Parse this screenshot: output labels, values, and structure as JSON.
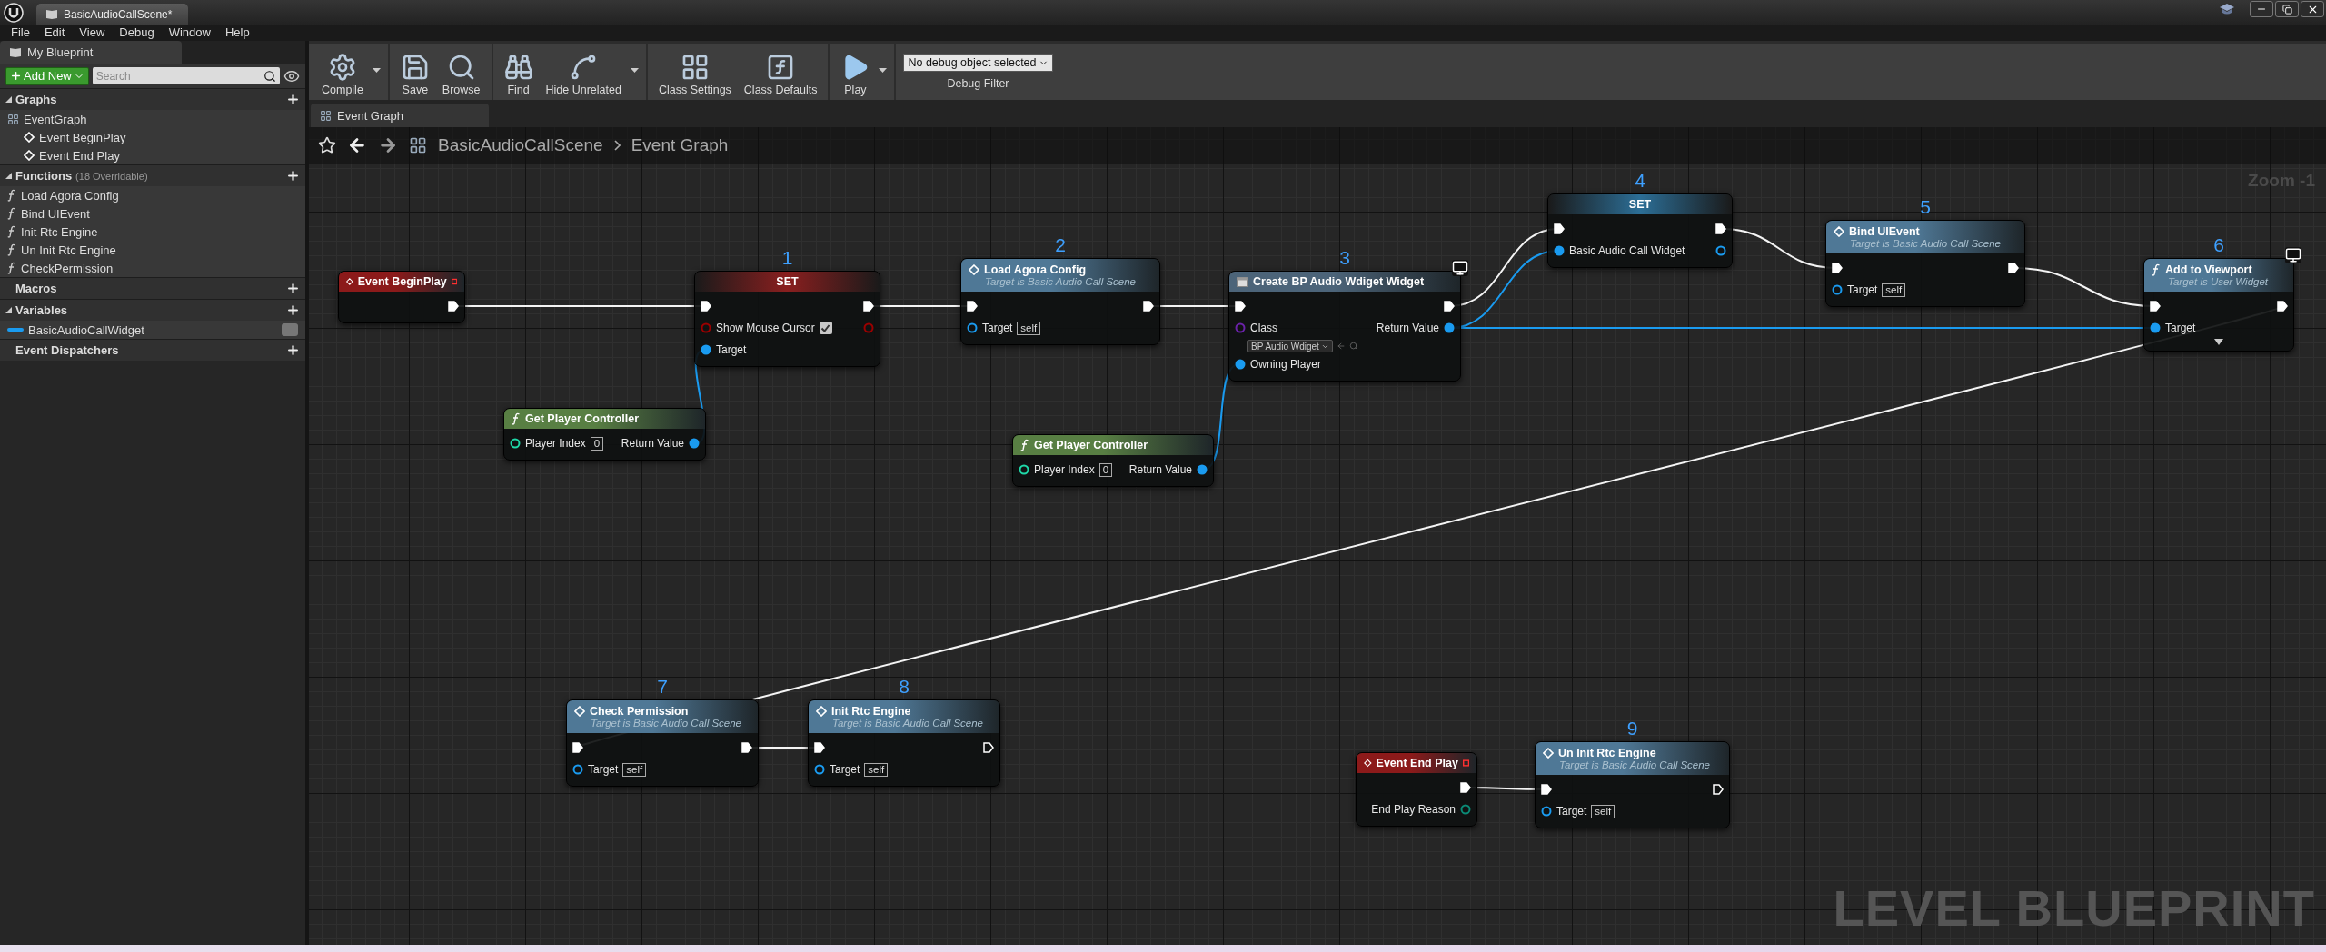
{
  "window": {
    "tab": "BasicAudioCallScene*"
  },
  "menu": [
    "File",
    "Edit",
    "View",
    "Debug",
    "Window",
    "Help"
  ],
  "my_blueprint": {
    "tab": "My Blueprint",
    "add_button": "Add New",
    "search_placeholder": "Search",
    "sections": [
      {
        "title": "Graphs",
        "expanded": true,
        "items": [
          {
            "label": "EventGraph",
            "kind": "graph",
            "children": [
              {
                "label": "Event BeginPlay",
                "kind": "event"
              },
              {
                "label": "Event End Play",
                "kind": "event"
              }
            ]
          }
        ]
      },
      {
        "title": "Functions",
        "note": "(18 Overridable)",
        "expanded": true,
        "items": [
          {
            "label": "Load Agora Config",
            "kind": "function"
          },
          {
            "label": "Bind UIEvent",
            "kind": "function"
          },
          {
            "label": "Init Rtc Engine",
            "kind": "function"
          },
          {
            "label": "Un Init Rtc Engine",
            "kind": "function"
          },
          {
            "label": "CheckPermission",
            "kind": "function"
          }
        ]
      },
      {
        "title": "Macros",
        "expanded": false
      },
      {
        "title": "Variables",
        "expanded": true,
        "items": [
          {
            "label": "BasicAudioCallWidget",
            "kind": "variable"
          }
        ]
      },
      {
        "title": "Event Dispatchers",
        "expanded": false
      }
    ]
  },
  "toolbar": {
    "groups": [
      [
        {
          "label": "Compile",
          "menu": true
        }
      ],
      [
        {
          "label": "Save",
          "menu": false
        },
        {
          "label": "Browse",
          "menu": false
        }
      ],
      [
        {
          "label": "Find",
          "menu": false
        },
        {
          "label": "Hide Unrelated",
          "menu": true
        }
      ],
      [
        {
          "label": "Class Settings",
          "menu": false
        },
        {
          "label": "Class Defaults",
          "menu": false
        }
      ],
      [
        {
          "label": "Play",
          "menu": true
        }
      ]
    ],
    "debug_filter": {
      "value": "No debug object selected",
      "label": "Debug Filter"
    }
  },
  "graph_tab": "Event Graph",
  "breadcrumb": [
    "BasicAudioCallScene",
    "Event Graph"
  ],
  "zoom": "Zoom -1",
  "graph_label": "LEVEL BLUEPRINT",
  "nodes": [
    {
      "kind": "event",
      "color": "#8c1a1a",
      "title": "Event BeginPlay",
      "rows": [
        {
          "out": {
            "kind": "exec",
            "connected": true
          }
        }
      ]
    },
    {
      "kind": "set",
      "step": "1",
      "color": "#8a1f1f",
      "title": "SET",
      "rows": [
        {
          "in": {
            "kind": "exec",
            "connected": true
          },
          "out": {
            "kind": "exec",
            "connected": true
          }
        },
        {
          "in": {
            "kind": "data",
            "color": "#9a0000",
            "label": "Show Mouse Cursor",
            "checked": true,
            "connected": false
          },
          "out": {
            "kind": "data",
            "color": "#9a0000",
            "connected": false
          }
        },
        {
          "in": {
            "kind": "data",
            "color": "#1a9bf0",
            "label": "Target",
            "connected": true
          }
        }
      ]
    },
    {
      "kind": "call",
      "step": "2",
      "color": "#4f7896",
      "title": "Load Agora Config",
      "subtitle": "Target is Basic Audio Call Scene",
      "rows": [
        {
          "in": {
            "kind": "exec",
            "connected": true
          },
          "out": {
            "kind": "exec",
            "connected": true
          }
        },
        {
          "in": {
            "kind": "data",
            "color": "#1a9bf0",
            "label": "Target",
            "value": "self",
            "connected": false
          }
        }
      ]
    },
    {
      "kind": "pure",
      "color": "#587f43",
      "title": "Get Player Controller",
      "rows": [
        {
          "in": {
            "kind": "data",
            "color": "#1fd8a8",
            "label": "Player Index",
            "value": "0",
            "connected": false
          },
          "out": {
            "kind": "data",
            "color": "#1a9bf0",
            "label": "Return Value",
            "connected": true
          }
        }
      ]
    },
    {
      "kind": "construct",
      "step": "3",
      "color": "#4c6479",
      "title": "Create BP Audio Wdiget Widget",
      "widget_badge": true,
      "rows": [
        {
          "in": {
            "kind": "exec",
            "connected": true
          },
          "out": {
            "kind": "exec",
            "connected": true
          }
        },
        {
          "in": {
            "kind": "data",
            "color": "#6a22a8",
            "label": "Class",
            "choice": "BP Audio Wdiget",
            "connected": false
          },
          "out": {
            "kind": "data",
            "color": "#1a9bf0",
            "label": "Return Value",
            "connected": true
          }
        },
        {
          "in": {
            "kind": "data",
            "color": "#1a9bf0",
            "label": "Owning Player",
            "connected": true
          }
        }
      ]
    },
    {
      "kind": "pure",
      "color": "#587f43",
      "title": "Get Player Controller",
      "rows": [
        {
          "in": {
            "kind": "data",
            "color": "#1fd8a8",
            "label": "Player Index",
            "value": "0",
            "connected": false
          },
          "out": {
            "kind": "data",
            "color": "#1a9bf0",
            "label": "Return Value",
            "connected": true
          }
        }
      ]
    },
    {
      "kind": "set",
      "step": "4",
      "color": "#2c6e96",
      "title": "SET",
      "rows": [
        {
          "in": {
            "kind": "exec",
            "connected": true
          },
          "out": {
            "kind": "exec",
            "connected": true
          }
        },
        {
          "in": {
            "kind": "data",
            "color": "#1a9bf0",
            "label": "Basic Audio Call Widget",
            "connected": true
          },
          "out": {
            "kind": "data",
            "color": "#1a9bf0",
            "connected": false
          }
        }
      ]
    },
    {
      "kind": "call",
      "step": "5",
      "color": "#4f7896",
      "title": "Bind UIEvent",
      "subtitle": "Target is Basic Audio Call Scene",
      "rows": [
        {
          "in": {
            "kind": "exec",
            "connected": true
          },
          "out": {
            "kind": "exec",
            "connected": true
          }
        },
        {
          "in": {
            "kind": "data",
            "color": "#1a9bf0",
            "label": "Target",
            "value": "self",
            "connected": false
          }
        }
      ]
    },
    {
      "kind": "function_call",
      "step": "6",
      "color": "#4f7896",
      "title": "Add to Viewport",
      "subtitle": "Target is User Widget",
      "widget_badge": true,
      "advanced": true,
      "rows": [
        {
          "in": {
            "kind": "exec",
            "connected": true
          },
          "out": {
            "kind": "exec",
            "connected": true
          }
        },
        {
          "in": {
            "kind": "data",
            "color": "#1a9bf0",
            "label": "Target",
            "connected": true
          }
        }
      ]
    },
    {
      "kind": "call",
      "step": "7",
      "color": "#4f7896",
      "title": "Check Permission",
      "subtitle": "Target is Basic Audio Call Scene",
      "rows": [
        {
          "in": {
            "kind": "exec",
            "connected": true
          },
          "out": {
            "kind": "exec",
            "connected": true
          }
        },
        {
          "in": {
            "kind": "data",
            "color": "#1a9bf0",
            "label": "Target",
            "value": "self",
            "connected": false
          }
        }
      ]
    },
    {
      "kind": "call",
      "step": "8",
      "color": "#4f7896",
      "title": "Init Rtc Engine",
      "subtitle": "Target is Basic Audio Call Scene",
      "rows": [
        {
          "in": {
            "kind": "exec",
            "connected": true
          },
          "out": {
            "kind": "exec",
            "connected": false
          }
        },
        {
          "in": {
            "kind": "data",
            "color": "#1a9bf0",
            "label": "Target",
            "value": "self",
            "connected": false
          }
        }
      ]
    },
    {
      "kind": "event",
      "color": "#8c1a1a",
      "title": "Event End Play",
      "rows": [
        {
          "out": {
            "kind": "exec",
            "connected": true
          }
        },
        {
          "out": {
            "kind": "data",
            "color": "#0b8a76",
            "label": "End Play Reason",
            "connected": false
          }
        }
      ]
    },
    {
      "kind": "call",
      "step": "9",
      "color": "#4f7896",
      "title": "Un Init Rtc Engine",
      "subtitle": "Target is Basic Audio Call Scene",
      "rows": [
        {
          "in": {
            "kind": "exec",
            "connected": true
          },
          "out": {
            "kind": "exec",
            "connected": false
          }
        },
        {
          "in": {
            "kind": "data",
            "color": "#1a9bf0",
            "label": "Target",
            "value": "self",
            "connected": false
          }
        }
      ]
    }
  ]
}
